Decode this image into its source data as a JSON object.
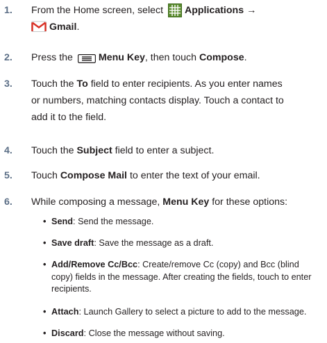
{
  "steps": [
    {
      "num": "1.",
      "t1": "From the Home screen, select ",
      "apps": "Applications",
      "arrow": "→",
      "gmail": "Gmail",
      "end": "."
    },
    {
      "num": "2.",
      "t1": "Press the ",
      "menu_key": "Menu Key",
      "t2": ", then touch ",
      "compose": "Compose",
      "end": "."
    },
    {
      "num": "3.",
      "t1": "Touch the ",
      "to": "To",
      "line1_rest": " field to enter recipients. As you enter names",
      "line2": "or numbers, matching contacts display. Touch a contact to",
      "line3": "add it to the field."
    },
    {
      "num": "4.",
      "t1": "Touch the ",
      "subject": "Subject",
      "t2": " field to enter a subject."
    },
    {
      "num": "5.",
      "t1": "Touch ",
      "compose_mail": "Compose Mail",
      "t2": " to enter the text of your email."
    },
    {
      "num": "6.",
      "t1": "While composing a message, ",
      "menu_key": "Menu Key",
      "t2": " for these options:"
    }
  ],
  "options": [
    {
      "label": "Send",
      "desc": ": Send the message."
    },
    {
      "label": "Save draft",
      "desc": ": Save the message as a draft."
    },
    {
      "label": "Add/Remove Cc/Bcc",
      "desc_line1": ": Create/remove Cc (copy) and Bcc (blind",
      "desc_line2": "copy) fields in the message. After creating the fields, touch to enter",
      "desc_line3": "recipients."
    },
    {
      "label": "Attach",
      "desc": ": Launch Gallery to select a picture to add to the message."
    },
    {
      "label": "Discard",
      "desc": ": Close the message without saving."
    }
  ],
  "icons": {
    "applications": "applications-grid-icon",
    "gmail": "gmail-icon",
    "menu_key": "menu-key-icon"
  },
  "colors": {
    "step_number": "#5b6e86",
    "text": "#231f20",
    "apps_icon": "#5a8b2e",
    "gmail_red": "#d93025"
  }
}
